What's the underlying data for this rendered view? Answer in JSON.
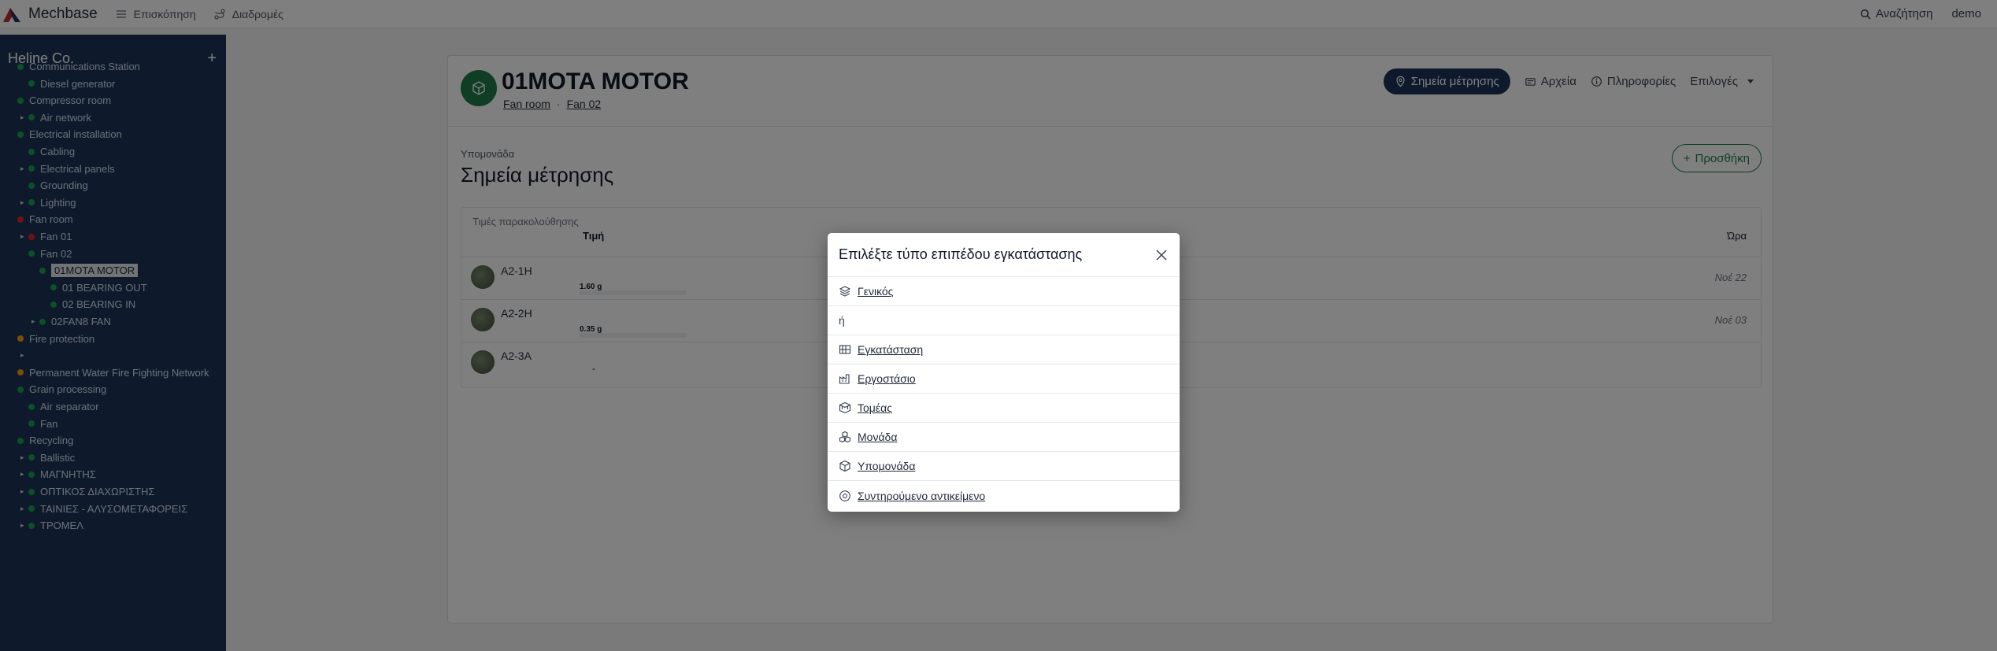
{
  "topbar": {
    "brand": "Mechbase",
    "nav": [
      {
        "label": "Επισκόπηση",
        "icon": "list-icon"
      },
      {
        "label": "Διαδρομές",
        "icon": "route-icon"
      }
    ],
    "search_label": "Αναζήτηση",
    "user": "demo"
  },
  "sidebar": {
    "title": "Heline Co.",
    "add": "+",
    "tree": [
      {
        "label": "Communications Station",
        "dot": "green",
        "level": 0,
        "caret": false
      },
      {
        "label": "Diesel generator",
        "dot": "green",
        "level": 1,
        "caret": false
      },
      {
        "label": "Compressor room",
        "dot": "green",
        "level": 0,
        "caret": false
      },
      {
        "label": "Air network",
        "dot": "green",
        "level": 1,
        "caret": true
      },
      {
        "label": "Electrical installation",
        "dot": "green",
        "level": 0,
        "caret": false
      },
      {
        "label": "Cabling",
        "dot": "green",
        "level": 1,
        "caret": false
      },
      {
        "label": "Electrical panels",
        "dot": "green",
        "level": 1,
        "caret": true
      },
      {
        "label": "Grounding",
        "dot": "green",
        "level": 1,
        "caret": false
      },
      {
        "label": "Lighting",
        "dot": "green",
        "level": 1,
        "caret": true
      },
      {
        "label": "Fan room",
        "dot": "red",
        "level": 0,
        "caret": false
      },
      {
        "label": "Fan 01",
        "dot": "red",
        "level": 1,
        "caret": true
      },
      {
        "label": "Fan 02",
        "dot": "green",
        "level": 1,
        "caret": false
      },
      {
        "label": "01MOTA MOTOR",
        "dot": "green",
        "level": 2,
        "caret": false,
        "selected": true
      },
      {
        "label": "01 BEARING OUT",
        "dot": "green",
        "level": 3,
        "caret": false
      },
      {
        "label": "02 BEARING IN",
        "dot": "green",
        "level": 3,
        "caret": false
      },
      {
        "label": "02FAN8 FAN",
        "dot": "green",
        "level": 2,
        "caret": true
      },
      {
        "label": "Fire protection",
        "dot": "orange",
        "level": 0,
        "caret": false
      },
      {
        "label": "",
        "dot": "none",
        "level": 1,
        "caret": true
      },
      {
        "label": "Permanent Water Fire Fighting Network",
        "dot": "orange",
        "level": 0,
        "caret": false
      },
      {
        "label": "Grain processing",
        "dot": "green",
        "level": 0,
        "caret": false
      },
      {
        "label": "Air separator",
        "dot": "green",
        "level": 1,
        "caret": false
      },
      {
        "label": "Fan",
        "dot": "green",
        "level": 1,
        "caret": false
      },
      {
        "label": "Recycling",
        "dot": "green",
        "level": 0,
        "caret": false
      },
      {
        "label": "Ballistic",
        "dot": "green",
        "level": 1,
        "caret": true
      },
      {
        "label": "ΜΑΓΝΗΤΗΣ",
        "dot": "green",
        "level": 1,
        "caret": true
      },
      {
        "label": "ΟΠΤΙΚΟΣ ΔΙΑΧΩΡΙΣΤΗΣ",
        "dot": "green",
        "level": 1,
        "caret": true
      },
      {
        "label": "ΤΑΙΝΙΕΣ - ΑΛΥΣΟΜΕΤΑΦΟΡΕΙΣ",
        "dot": "green",
        "level": 1,
        "caret": true
      },
      {
        "label": "ΤΡΟΜΕΛ",
        "dot": "green",
        "level": 1,
        "caret": true
      }
    ]
  },
  "asset": {
    "title": "01MOTA MOTOR",
    "crumbs": [
      "Fan room",
      "Fan 02"
    ],
    "crumb_sep": "·",
    "tabs": [
      {
        "label": "Σημεία μέτρησης",
        "icon": "location-pin-icon",
        "active": true
      },
      {
        "label": "Αρχεία",
        "icon": "files-icon",
        "active": false
      },
      {
        "label": "Πληροφορίες",
        "icon": "info-icon",
        "active": false
      },
      {
        "label": "Επιλογές",
        "icon": "",
        "active": false,
        "dropdown": true
      }
    ]
  },
  "section": {
    "sub": "Υπομονάδα",
    "title": "Σημεία μέτρησης",
    "add_label": "Προσθήκη"
  },
  "table": {
    "caption": "Τιμές παρακολούθησης",
    "col_value": "Τιμή",
    "col_time": "Ώρα",
    "rows": [
      {
        "name": "A2-1H",
        "value": "1.60 g",
        "time": "Νοέ 22"
      },
      {
        "name": "A2-2H",
        "value": "0.35 g",
        "time": "Νοέ 03"
      },
      {
        "name": "A2-3A",
        "value": "-",
        "time": ""
      }
    ]
  },
  "modal": {
    "title": "Επιλέξτε τύπο επιπέδου εγκατάστασης",
    "general": "Γενικός",
    "or": "ή",
    "options": [
      {
        "label": "Εγκατάσταση",
        "icon": "installation-icon"
      },
      {
        "label": "Εργοστάσιο",
        "icon": "factory-icon"
      },
      {
        "label": "Τομέας",
        "icon": "sector-icon"
      },
      {
        "label": "Μονάδα",
        "icon": "unit-icon"
      },
      {
        "label": "Υπομονάδα",
        "icon": "subunit-icon"
      },
      {
        "label": "Συντηρούμενο αντικείμενο",
        "icon": "maintained-object-icon"
      }
    ]
  }
}
